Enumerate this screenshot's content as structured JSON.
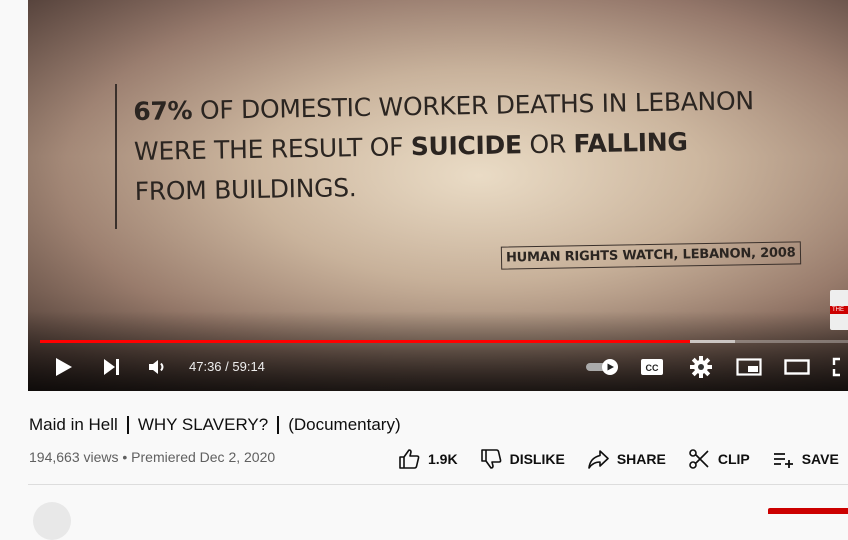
{
  "video": {
    "overlay": {
      "prefix_bold": "67%",
      "line1_rest": " OF DOMESTIC WORKER DEATHS IN LEBANON",
      "line2_start": "WERE THE RESULT OF ",
      "line2_bold1": "SUICIDE",
      "line2_mid": " OR ",
      "line2_bold2": "FALLING",
      "line3": "FROM BUILDINGS.",
      "source": "HUMAN RIGHTS WATCH, LEBANON, 2008"
    },
    "side_thumb_text": "THE",
    "progress": {
      "played_fraction": 0.805,
      "loaded_fraction": 0.86
    },
    "time_display": "47:36 / 59:14"
  },
  "controls": {
    "icons": [
      "play-icon",
      "next-icon",
      "volume-icon",
      "autoplay-toggle-icon",
      "captions-icon",
      "settings-icon",
      "miniplayer-icon",
      "theater-icon",
      "fullscreen-icon"
    ],
    "cc_label": "CC"
  },
  "info": {
    "title_parts": [
      "Maid in Hell",
      "WHY SLAVERY?",
      "(Documentary)"
    ],
    "meta": "194,663 views • Premiered Dec 2, 2020",
    "actions": {
      "like": "1.9K",
      "dislike": "DISLIKE",
      "share": "SHARE",
      "clip": "CLIP",
      "save": "SAVE"
    }
  },
  "colors": {
    "accent": "#ff0000",
    "text": "#0f0f0f",
    "meta": "#606060"
  }
}
